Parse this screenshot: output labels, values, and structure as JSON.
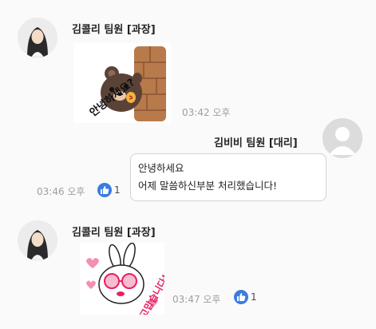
{
  "messages": [
    {
      "sender": "김콜리 팀원 [과장]",
      "sticker": "bear-hello-sticker",
      "sticker_text": "안녕하세요?",
      "time": "03:42 오후"
    },
    {
      "sender": "김비비 팀원 [대리]",
      "lines": [
        "안녕하세요",
        "어제 말씀하신부분 처리했습니다!"
      ],
      "time": "03:46 오후",
      "likes": "1"
    },
    {
      "sender": "김콜리 팀원 [과장]",
      "sticker": "bunny-thanks-sticker",
      "sticker_text": "고맙습니다!",
      "time": "03:47 오후",
      "likes": "1"
    }
  ],
  "colors": {
    "like_blue": "#3b7ddd",
    "bubble_border": "#cfd3d8",
    "time_gray": "#9aa0a6"
  }
}
